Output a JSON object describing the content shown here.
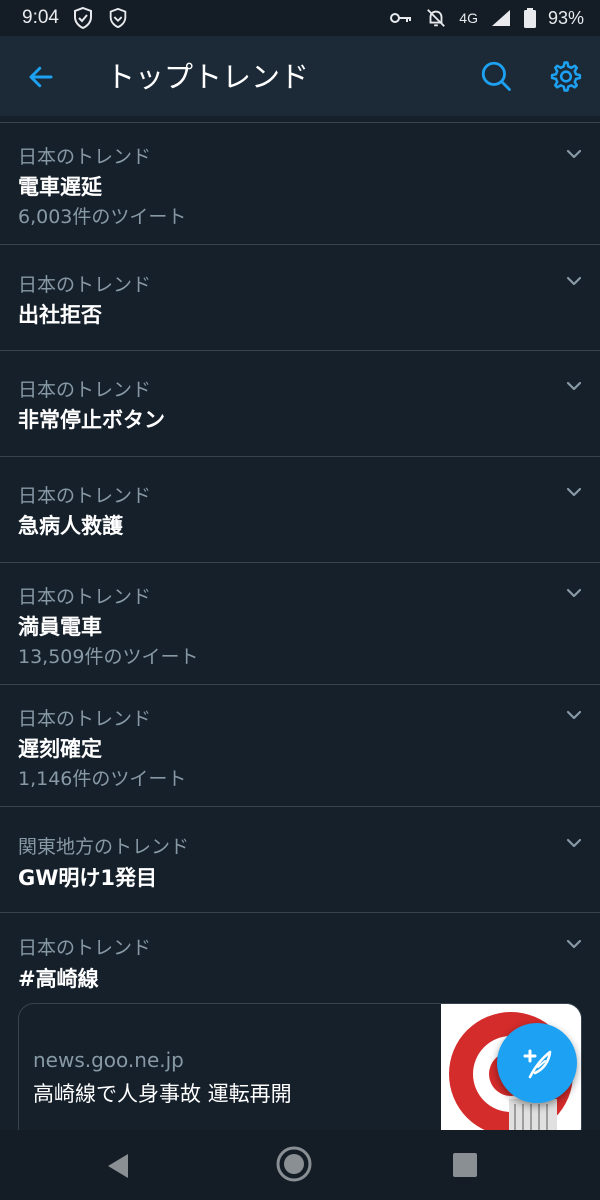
{
  "status_bar": {
    "time": "9:04",
    "network": "4G",
    "battery": "93%",
    "icons": [
      "shield-check-icon",
      "shield-icon",
      "key-icon",
      "bell-off-icon",
      "signal-icon",
      "battery-icon"
    ]
  },
  "app_bar": {
    "title": "トップトレンド",
    "icons": [
      "back-arrow-icon",
      "search-icon",
      "gear-icon"
    ]
  },
  "trends": [
    {
      "context": "日本のトレンド",
      "name": "電車遅延",
      "count": "6,003件のツイート"
    },
    {
      "context": "日本のトレンド",
      "name": "出社拒否",
      "count": ""
    },
    {
      "context": "日本のトレンド",
      "name": "非常停止ボタン",
      "count": ""
    },
    {
      "context": "日本のトレンド",
      "name": "急病人救護",
      "count": ""
    },
    {
      "context": "日本のトレンド",
      "name": "満員電車",
      "count": "13,509件のツイート"
    },
    {
      "context": "日本のトレンド",
      "name": "遅刻確定",
      "count": "1,146件のツイート"
    },
    {
      "context": "関東地方のトレンド",
      "name": "GW明け1発目",
      "count": ""
    },
    {
      "context": "日本のトレンド",
      "name": "#高崎線",
      "count": ""
    }
  ],
  "news_card": {
    "domain": "news.goo.ne.jp",
    "headline": "高崎線で人身事故 運転再開"
  },
  "colors": {
    "background": "#15202b",
    "app_bar": "#1c2a38",
    "accent": "#1da1f2",
    "secondary_text": "#8899a6",
    "divider": "#38444d"
  },
  "fab": {
    "icon": "compose-feather-icon"
  },
  "nav_bar": {
    "icons": [
      "nav-back-icon",
      "nav-home-icon",
      "nav-recents-icon"
    ]
  }
}
